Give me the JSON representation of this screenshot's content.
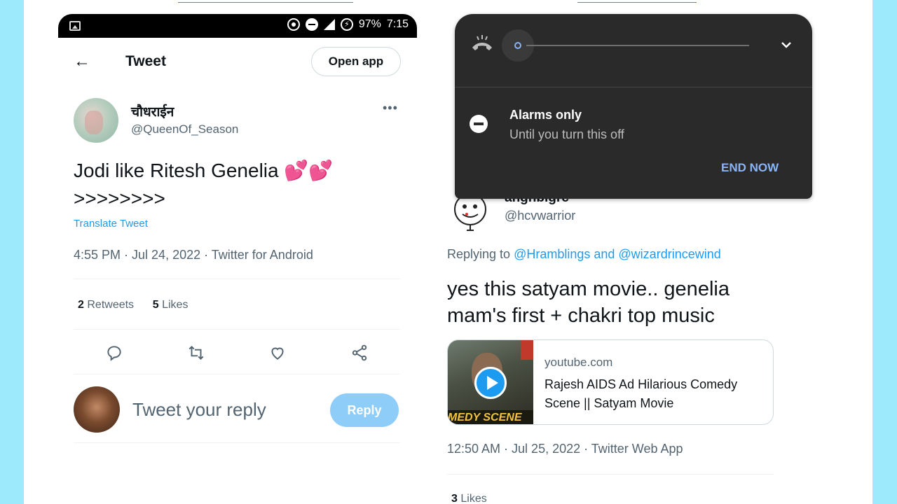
{
  "left": {
    "status": {
      "battery": "97%",
      "time": "7:15"
    },
    "header": {
      "title": "Tweet",
      "open_app_label": "Open app"
    },
    "tweet": {
      "display_name": "चौधराईन",
      "handle": "@QueenOf_Season",
      "text": "Jodi like Ritesh Genelia",
      "text_line2": ">>>>>>>>",
      "emoji": "💕💕",
      "translate_label": "Translate Tweet",
      "meta": "4:55 PM · Jul 24, 2022 · Twitter for Android",
      "retweets_count": "2",
      "retweets_label": "Retweets",
      "likes_count": "5",
      "likes_label": "Likes"
    },
    "reply": {
      "placeholder": "Tweet your reply",
      "button_label": "Reply"
    }
  },
  "right": {
    "tweet": {
      "display_name": "anghbigrc",
      "handle": "@hcvwarrior",
      "replying_prefix": "Replying to",
      "replying_to": "@Hramblings and @wizardrincewind",
      "text": "yes this satyam movie.. genelia mam's first + chakri top music",
      "card": {
        "domain": "youtube.com",
        "title": "Rajesh AIDS Ad Hilarious Comedy Scene || Satyam Movie",
        "thumbnail_caption": "MEDY SCENE"
      },
      "meta": "12:50 AM · Jul 25, 2022 · Twitter Web App",
      "likes_count": "3",
      "likes_label": "Likes"
    }
  },
  "notification_panel": {
    "mode_title": "Alarms only",
    "mode_subtitle": "Until you turn this off",
    "end_label": "END NOW",
    "accent_color": "#8ab4f8"
  },
  "colors": {
    "background": "#9eeafd",
    "link": "#1d9bf0",
    "reply_button": "#8ecdf8"
  }
}
